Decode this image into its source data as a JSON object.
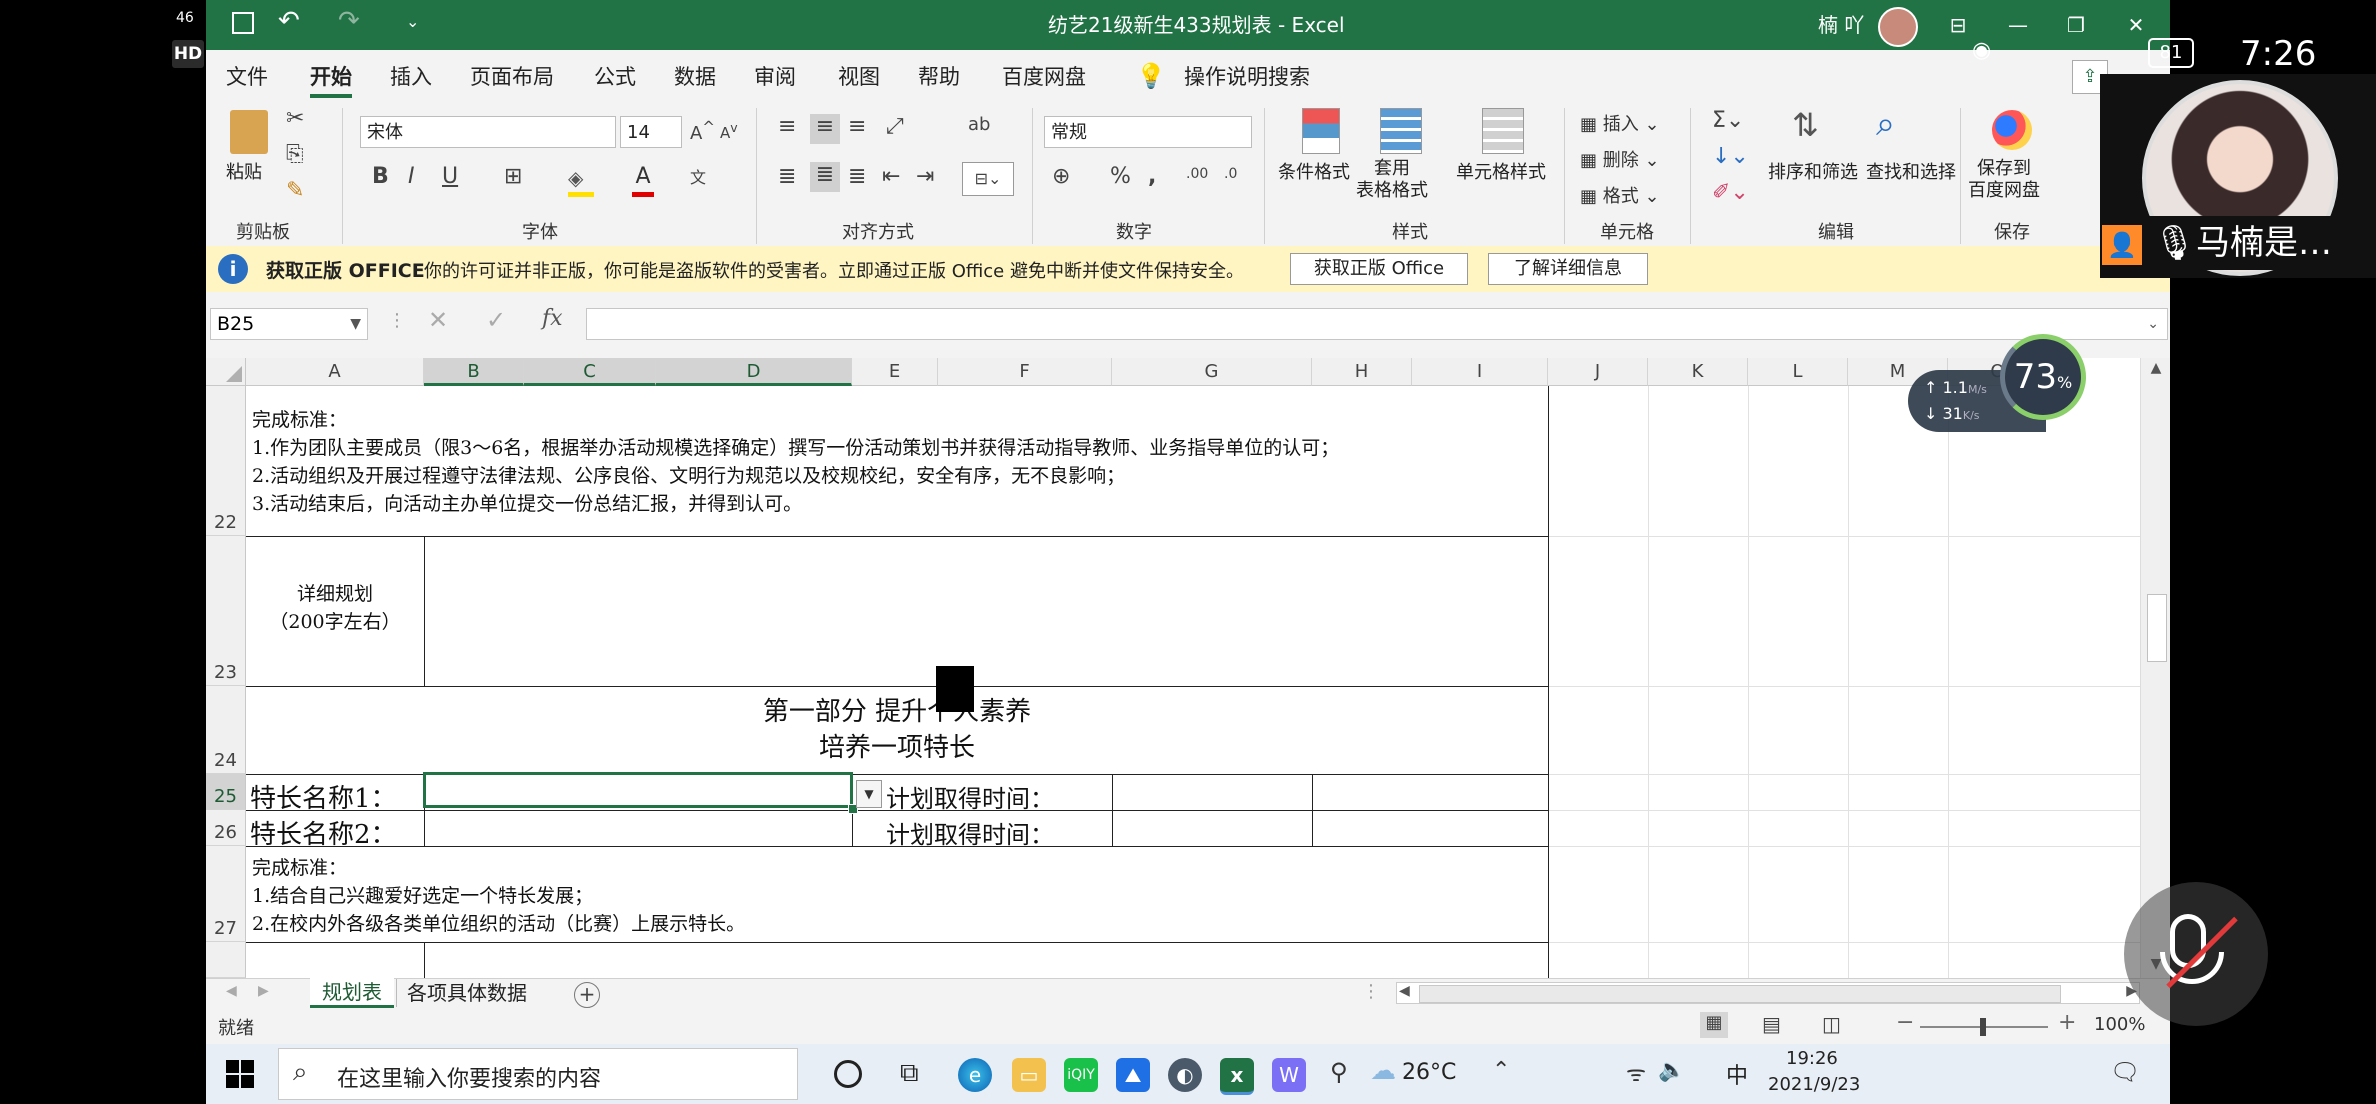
{
  "app": {
    "title": "纺艺21级新生433规划表  -  Excel",
    "user": "楠 吖",
    "hd_badge": "HD",
    "phone_status": {
      "network": "46",
      "battery": "81",
      "time": "7:26"
    }
  },
  "ribbon_tabs": [
    "文件",
    "开始",
    "插入",
    "页面布局",
    "公式",
    "数据",
    "审阅",
    "视图",
    "帮助",
    "百度网盘"
  ],
  "active_tab": "开始",
  "tell_me": "操作说明搜索",
  "ribbon": {
    "paste": "粘贴",
    "font_name": "宋体",
    "font_size": "14",
    "number_format": "常规",
    "conditional_format": "条件格式",
    "table_format": "套用\n表格格式",
    "cell_styles": "单元格样式",
    "insert": "插入",
    "delete": "删除",
    "format": "格式",
    "sort_filter": "排序和筛选",
    "find_select": "查找和选择",
    "save_to_pan": "保存到\n百度网盘",
    "groups": [
      "剪贴板",
      "字体",
      "对齐方式",
      "数字",
      "样式",
      "单元格",
      "编辑",
      "保存"
    ],
    "colors": {
      "fill": "#FFE000",
      "font": "#E00000"
    }
  },
  "infobar": {
    "title": "获取正版 OFFICE",
    "message": "你的许可证并非正版，你可能是盗版软件的受害者。立即通过正版 Office 避免中断并使文件保持安全。",
    "btn_get": "获取正版 Office",
    "btn_learn": "了解详细信息"
  },
  "formula_bar": {
    "name_box": "B25",
    "value": ""
  },
  "columns": [
    "A",
    "B",
    "C",
    "D",
    "E",
    "F",
    "G",
    "H",
    "I",
    "J",
    "K",
    "L",
    "M",
    "O"
  ],
  "rows": {
    "r22": {
      "num": "22",
      "lines": [
        "完成标准：",
        "1.作为团队主要成员（限3～6名，根据举办活动规模选择确定）撰写一份活动策划书并获得活动指导教师、业务指导单位的认可；",
        "2.活动组织及开展过程遵守法律法规、公序良俗、文明行为规范以及校规校纪，安全有序，无不良影响；",
        "3.活动结束后，向活动主办单位提交一份总结汇报，并得到认可。"
      ]
    },
    "r23": {
      "num": "23",
      "label_line1": "详细规划",
      "label_line2": "（200字左右）"
    },
    "r24": {
      "num": "24",
      "line1": "第一部分  提升个人素养",
      "line2": "培养一项特长"
    },
    "r25": {
      "num": "25",
      "a": "特长名称1：",
      "e": "计划取得时间："
    },
    "r26": {
      "num": "26",
      "a": "特长名称2：",
      "e": "计划取得时间："
    },
    "r27": {
      "num": "27",
      "lines": [
        "完成标准：",
        "1.结合自己兴趣爱好选定一个特长发展；",
        "2.在校内外各级各类单位组织的活动（比赛）上展示特长。"
      ]
    }
  },
  "overlay": {
    "cpu_pct": "73",
    "pct_sign": "%",
    "up": "1.1",
    "up_unit": "M/s",
    "down": "31",
    "down_unit": "K/s"
  },
  "sheet_tabs": [
    "规划表",
    "各项具体数据"
  ],
  "active_sheet": "规划表",
  "status": {
    "ready": "就绪",
    "zoom": "100%"
  },
  "taskbar": {
    "search_placeholder": "在这里输入你要搜索的内容",
    "weather": "26°C",
    "ime": "中",
    "time": "19:26",
    "date": "2021/9/23"
  },
  "call": {
    "name": "马楠是…"
  }
}
